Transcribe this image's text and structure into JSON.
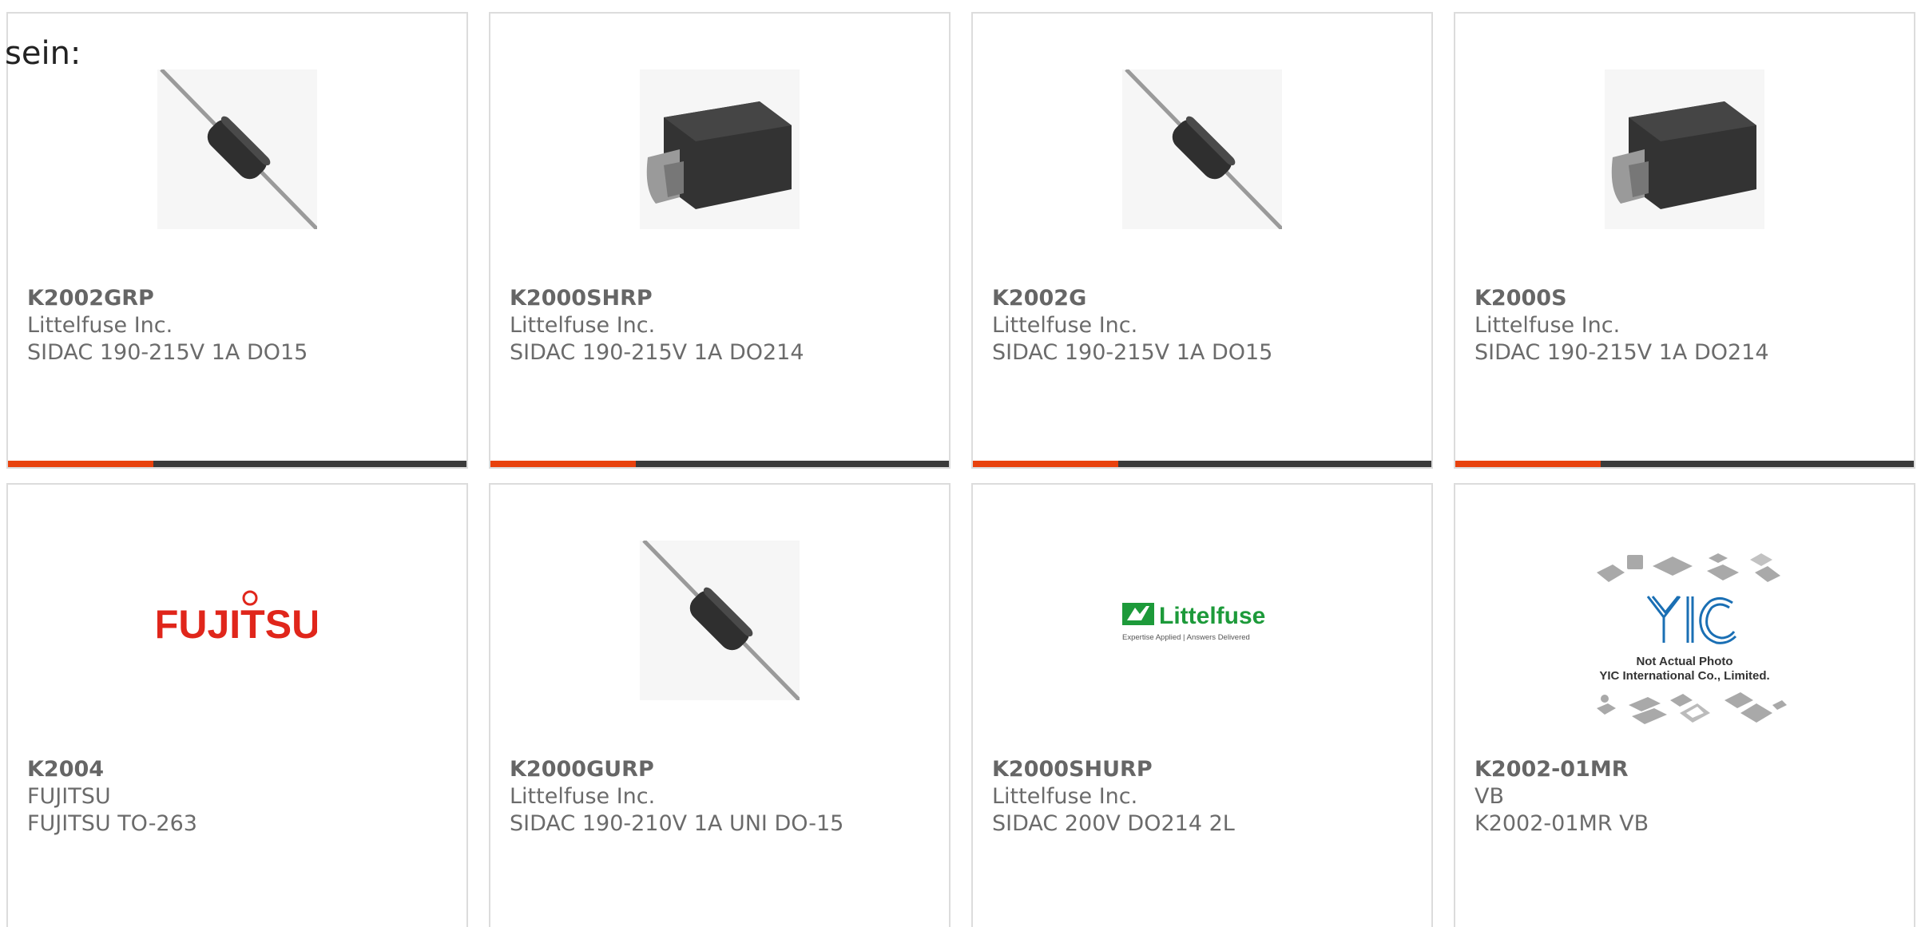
{
  "intro_text": "sein:",
  "colors": {
    "accent": "#e8420e",
    "bar_dark": "#3b3b3b",
    "border": "#dcdcdc",
    "text": "#6b6b6b",
    "fujitsu_red": "#e0261b",
    "littelfuse_green": "#1d9a3a",
    "yic_blue": "#1a6fb4"
  },
  "products": [
    {
      "part_number": "K2002GRP",
      "manufacturer": "Littelfuse Inc.",
      "description": "SIDAC 190-215V 1A DO15",
      "image": "axial-diode"
    },
    {
      "part_number": "K2000SHRP",
      "manufacturer": "Littelfuse Inc.",
      "description": "SIDAC 190-215V 1A DO214",
      "image": "smd-diode"
    },
    {
      "part_number": "K2002G",
      "manufacturer": "Littelfuse Inc.",
      "description": "SIDAC 190-215V 1A DO15",
      "image": "axial-diode"
    },
    {
      "part_number": "K2000S",
      "manufacturer": "Littelfuse Inc.",
      "description": "SIDAC 190-215V 1A DO214",
      "image": "smd-diode"
    },
    {
      "part_number": "K2004",
      "manufacturer": "FUJITSU",
      "description": "FUJITSU TO-263",
      "image": "fujitsu-logo",
      "logo_text": "FUJITSU"
    },
    {
      "part_number": "K2000GURP",
      "manufacturer": "Littelfuse Inc.",
      "description": "SIDAC 190-210V 1A UNI DO-15",
      "image": "axial-diode"
    },
    {
      "part_number": "K2000SHURP",
      "manufacturer": "Littelfuse Inc.",
      "description": "SIDAC 200V DO214 2L",
      "image": "littelfuse-logo",
      "logo_text": "Littelfuse",
      "logo_tagline": "Expertise Applied | Answers Delivered"
    },
    {
      "part_number": "K2002-01MR",
      "manufacturer": "VB",
      "description": "K2002-01MR VB",
      "image": "yic-placeholder",
      "logo_text": "YIC",
      "caption_line1": "Not Actual Photo",
      "caption_line2": "YIC International Co., Limited."
    }
  ]
}
